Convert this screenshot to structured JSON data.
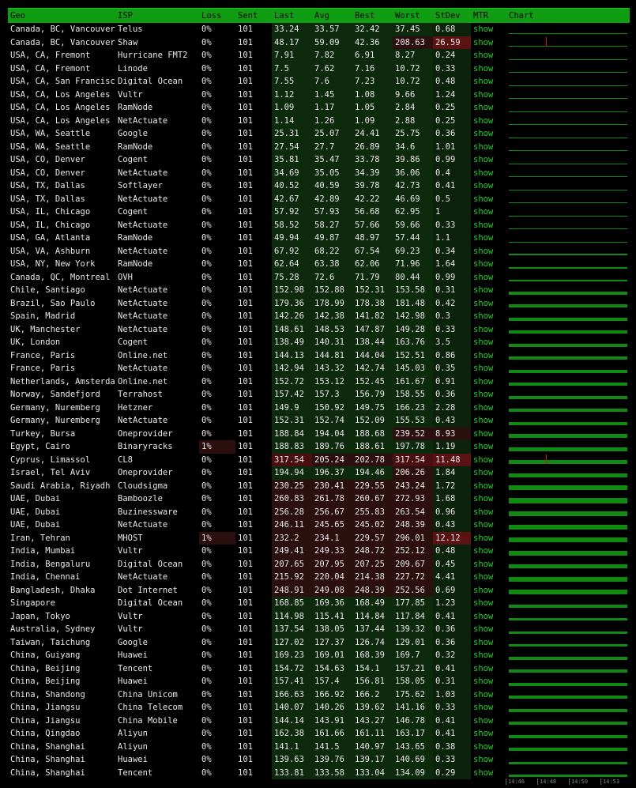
{
  "header": [
    "Geo",
    "ISP",
    "Loss",
    "Sent",
    "Last",
    "Avg",
    "Best",
    "Worst",
    "StDev",
    "MTR",
    "Chart"
  ],
  "mtr_label": "show",
  "colors": {
    "header_bg": "#0f9d12",
    "link": "#18d41b",
    "good": "#0e2a0e",
    "bad": "#2c0f0f",
    "bar": "#118a13"
  },
  "axis_labels": [
    "14:46",
    "14:48",
    "14:50",
    "14:53"
  ],
  "rows": [
    [
      "Canada, BC, Vancouver",
      "Telus",
      "0%",
      "101",
      "33.24",
      "33.57",
      "32.42",
      "37.45",
      "0.68"
    ],
    [
      "Canada, BC, Vancouver",
      "Shaw",
      "0%",
      "101",
      "48.17",
      "59.09",
      "42.36",
      "208.63",
      "26.59"
    ],
    [
      "USA, CA, Fremont",
      "Hurricane FMT2",
      "0%",
      "101",
      "7.91",
      "7.82",
      "6.91",
      "8.27",
      "0.24"
    ],
    [
      "USA, CA, Fremont",
      "Linode",
      "0%",
      "101",
      "7.5",
      "7.62",
      "7.16",
      "10.72",
      "0.33"
    ],
    [
      "USA, CA, San Francisco",
      "Digital Ocean",
      "0%",
      "101",
      "7.55",
      "7.6",
      "7.23",
      "10.72",
      "0.48"
    ],
    [
      "USA, CA, Los Angeles",
      "Vultr",
      "0%",
      "101",
      "1.12",
      "1.45",
      "1.08",
      "9.66",
      "1.24"
    ],
    [
      "USA, CA, Los Angeles",
      "RamNode",
      "0%",
      "101",
      "1.09",
      "1.17",
      "1.05",
      "2.84",
      "0.25"
    ],
    [
      "USA, CA, Los Angeles",
      "NetActuate",
      "0%",
      "101",
      "1.14",
      "1.26",
      "1.09",
      "2.88",
      "0.25"
    ],
    [
      "USA, WA, Seattle",
      "Google",
      "0%",
      "101",
      "25.31",
      "25.07",
      "24.41",
      "25.75",
      "0.36"
    ],
    [
      "USA, WA, Seattle",
      "RamNode",
      "0%",
      "101",
      "27.54",
      "27.7",
      "26.89",
      "34.6",
      "1.01"
    ],
    [
      "USA, CO, Denver",
      "Cogent",
      "0%",
      "101",
      "35.81",
      "35.47",
      "33.78",
      "39.86",
      "0.99"
    ],
    [
      "USA, CO, Denver",
      "NetActuate",
      "0%",
      "101",
      "34.69",
      "35.05",
      "34.39",
      "36.06",
      "0.4"
    ],
    [
      "USA, TX, Dallas",
      "Softlayer",
      "0%",
      "101",
      "40.52",
      "40.59",
      "39.78",
      "42.73",
      "0.41"
    ],
    [
      "USA, TX, Dallas",
      "NetActuate",
      "0%",
      "101",
      "42.67",
      "42.89",
      "42.22",
      "46.69",
      "0.5"
    ],
    [
      "USA, IL, Chicago",
      "Cogent",
      "0%",
      "101",
      "57.92",
      "57.93",
      "56.68",
      "62.95",
      "1"
    ],
    [
      "USA, IL, Chicago",
      "NetActuate",
      "0%",
      "101",
      "58.52",
      "58.27",
      "57.66",
      "59.66",
      "0.33"
    ],
    [
      "USA, GA, Atlanta",
      "RamNode",
      "0%",
      "101",
      "49.94",
      "49.87",
      "48.97",
      "57.44",
      "1.1"
    ],
    [
      "USA, VA, Ashburn",
      "NetActuate",
      "0%",
      "101",
      "67.92",
      "68.22",
      "67.54",
      "69.23",
      "0.34"
    ],
    [
      "USA, NY, New York",
      "RamNode",
      "0%",
      "101",
      "62.64",
      "63.38",
      "62.06",
      "71.96",
      "1.64"
    ],
    [
      "Canada, QC, Montreal",
      "OVH",
      "0%",
      "101",
      "75.28",
      "72.6",
      "71.79",
      "80.44",
      "0.99"
    ],
    [
      "Chile, Santiago",
      "NetActuate",
      "0%",
      "101",
      "152.98",
      "152.88",
      "152.31",
      "153.58",
      "0.31"
    ],
    [
      "Brazil, Sao Paulo",
      "NetActuate",
      "0%",
      "101",
      "179.36",
      "178.99",
      "178.38",
      "181.48",
      "0.42"
    ],
    [
      "Spain, Madrid",
      "NetActuate",
      "0%",
      "101",
      "142.26",
      "142.38",
      "141.82",
      "142.98",
      "0.3"
    ],
    [
      "UK, Manchester",
      "NetActuate",
      "0%",
      "101",
      "148.61",
      "148.53",
      "147.87",
      "149.28",
      "0.33"
    ],
    [
      "UK, London",
      "Cogent",
      "0%",
      "101",
      "138.49",
      "140.31",
      "138.44",
      "163.76",
      "3.5"
    ],
    [
      "France, Paris",
      "Online.net",
      "0%",
      "101",
      "144.13",
      "144.81",
      "144.04",
      "152.51",
      "0.86"
    ],
    [
      "France, Paris",
      "NetActuate",
      "0%",
      "101",
      "142.94",
      "143.32",
      "142.74",
      "145.03",
      "0.35"
    ],
    [
      "Netherlands, Amsterdam",
      "Online.net",
      "0%",
      "101",
      "152.72",
      "153.12",
      "152.45",
      "161.67",
      "0.91"
    ],
    [
      "Norway, Sandefjord",
      "Terrahost",
      "0%",
      "101",
      "157.42",
      "157.3",
      "156.79",
      "158.55",
      "0.36"
    ],
    [
      "Germany, Nuremberg",
      "Hetzner",
      "0%",
      "101",
      "149.9",
      "150.92",
      "149.75",
      "166.23",
      "2.28"
    ],
    [
      "Germany, Nuremberg",
      "NetActuate",
      "0%",
      "101",
      "152.31",
      "152.74",
      "152.09",
      "155.53",
      "0.43"
    ],
    [
      "Turkey, Bursa",
      "Oneprovider",
      "0%",
      "101",
      "188.84",
      "194.04",
      "188.68",
      "239.52",
      "8.93"
    ],
    [
      "Egypt, Cairo",
      "Binaryracks",
      "1%",
      "101",
      "188.83",
      "189.76",
      "188.61",
      "197.78",
      "1.19"
    ],
    [
      "Cyprus, Limassol",
      "CL8",
      "0%",
      "101",
      "317.54",
      "205.24",
      "202.78",
      "317.54",
      "11.48"
    ],
    [
      "Israel, Tel Aviv",
      "Oneprovider",
      "0%",
      "101",
      "194.94",
      "196.37",
      "194.46",
      "206.26",
      "1.84"
    ],
    [
      "Saudi Arabia, Riyadh",
      "Cloudsigma",
      "0%",
      "101",
      "230.25",
      "230.41",
      "229.55",
      "243.24",
      "1.72"
    ],
    [
      "UAE, Dubai",
      "Bamboozle",
      "0%",
      "101",
      "260.83",
      "261.78",
      "260.67",
      "272.93",
      "1.68"
    ],
    [
      "UAE, Dubai",
      "Buzinessware",
      "0%",
      "101",
      "256.28",
      "256.67",
      "255.83",
      "263.54",
      "0.96"
    ],
    [
      "UAE, Dubai",
      "NetActuate",
      "0%",
      "101",
      "246.11",
      "245.65",
      "245.02",
      "248.39",
      "0.43"
    ],
    [
      "Iran, Tehran",
      "MHOST",
      "1%",
      "101",
      "232.2",
      "234.1",
      "229.57",
      "296.01",
      "12.12"
    ],
    [
      "India, Mumbai",
      "Vultr",
      "0%",
      "101",
      "249.41",
      "249.33",
      "248.72",
      "252.12",
      "0.48"
    ],
    [
      "India, Bengaluru",
      "Digital Ocean",
      "0%",
      "101",
      "207.65",
      "207.95",
      "207.25",
      "209.67",
      "0.45"
    ],
    [
      "India, Chennai",
      "NetActuate",
      "0%",
      "101",
      "215.92",
      "220.04",
      "214.38",
      "227.72",
      "4.41"
    ],
    [
      "Bangladesh, Dhaka",
      "Dot Internet",
      "0%",
      "101",
      "248.91",
      "249.08",
      "248.39",
      "252.56",
      "0.69"
    ],
    [
      "Singapore",
      "Digital Ocean",
      "0%",
      "101",
      "168.85",
      "169.36",
      "168.49",
      "177.85",
      "1.23"
    ],
    [
      "Japan, Tokyo",
      "Vultr",
      "0%",
      "101",
      "114.98",
      "115.41",
      "114.84",
      "117.84",
      "0.41"
    ],
    [
      "Australia, Sydney",
      "Vultr",
      "0%",
      "101",
      "137.54",
      "138.05",
      "137.44",
      "139.32",
      "0.36"
    ],
    [
      "Taiwan, Taichung",
      "Google",
      "0%",
      "101",
      "127.02",
      "127.37",
      "126.74",
      "129.01",
      "0.36"
    ],
    [
      "China, Guiyang",
      "Huawei",
      "0%",
      "101",
      "169.23",
      "169.01",
      "168.39",
      "169.7",
      "0.32"
    ],
    [
      "China, Beijing",
      "Tencent",
      "0%",
      "101",
      "154.72",
      "154.63",
      "154.1",
      "157.21",
      "0.41"
    ],
    [
      "China, Beijing",
      "Huawei",
      "0%",
      "101",
      "157.41",
      "157.4",
      "156.81",
      "158.05",
      "0.31"
    ],
    [
      "China, Shandong",
      "China Unicom",
      "0%",
      "101",
      "166.63",
      "166.92",
      "166.2",
      "175.62",
      "1.03"
    ],
    [
      "China, Jiangsu",
      "China Telecom",
      "0%",
      "101",
      "140.07",
      "140.26",
      "139.62",
      "141.16",
      "0.33"
    ],
    [
      "China, Jiangsu",
      "China Mobile",
      "0%",
      "101",
      "144.14",
      "143.91",
      "143.27",
      "146.78",
      "0.41"
    ],
    [
      "China, Qingdao",
      "Aliyun",
      "0%",
      "101",
      "162.38",
      "161.66",
      "161.11",
      "163.17",
      "0.41"
    ],
    [
      "China, Shanghai",
      "Aliyun",
      "0%",
      "101",
      "141.1",
      "141.5",
      "140.97",
      "143.65",
      "0.38"
    ],
    [
      "China, Shanghai",
      "Huawei",
      "0%",
      "101",
      "139.63",
      "139.76",
      "139.17",
      "140.69",
      "0.33"
    ],
    [
      "China, Shanghai",
      "Tencent",
      "0%",
      "101",
      "133.81",
      "133.58",
      "133.04",
      "134.09",
      "0.29"
    ]
  ]
}
